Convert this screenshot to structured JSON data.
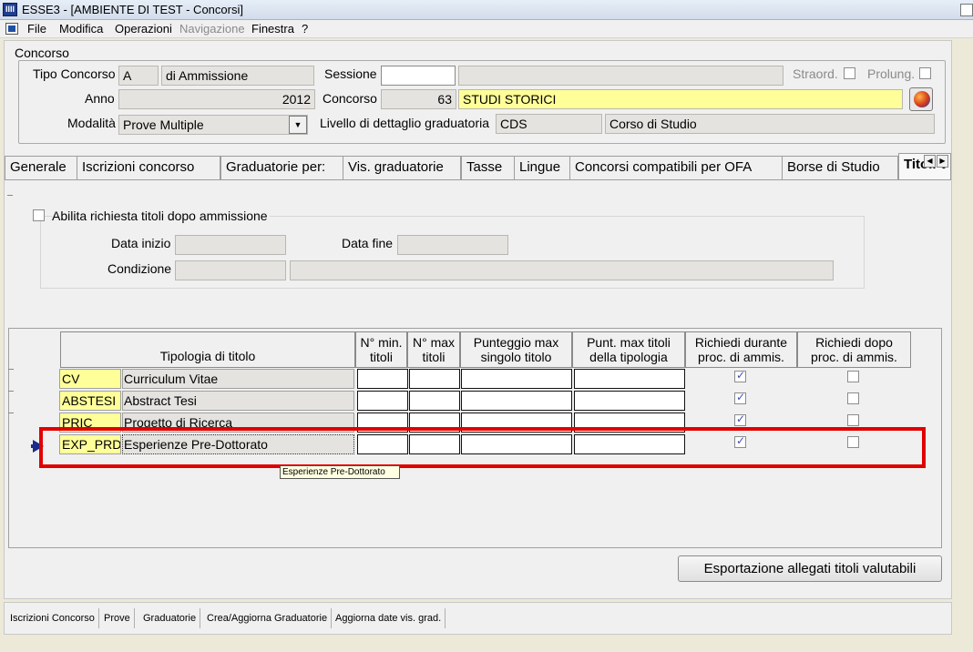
{
  "window": {
    "title": "ESSE3 - [AMBIENTE DI TEST - Concorsi]",
    "app_icon_text": "IIII"
  },
  "menu": {
    "items": [
      "File",
      "Modifica",
      "Operazioni",
      "Navigazione",
      "Finestra",
      "?"
    ],
    "disabled": [
      "Navigazione"
    ]
  },
  "concorso": {
    "group_title": "Concorso",
    "tipo_label": "Tipo Concorso",
    "tipo_code": "A",
    "tipo_desc": "di Ammissione",
    "sessione_label": "Sessione",
    "sessione_value": "",
    "sessione_desc": "",
    "straord_label": "Straord.",
    "prolung_label": "Prolung.",
    "anno_label": "Anno",
    "anno_value": "2012",
    "concorso_label": "Concorso",
    "concorso_code": "63",
    "concorso_desc": "STUDI STORICI",
    "modalita_label": "Modalità",
    "modalita_value": "Prove Multiple",
    "livello_label": "Livello di dettaglio graduatoria",
    "livello_code": "CDS",
    "livello_desc": "Corso di Studio"
  },
  "tabs": [
    "Generale",
    "Iscrizioni concorso",
    "Graduatorie per:",
    "Vis. graduatorie",
    "Tasse",
    "Lingue",
    "Concorsi compatibili per OFA",
    "Borse di Studio",
    "Titoli v"
  ],
  "active_tab": "Titoli v",
  "abilita": {
    "checkbox_label": "Abilita richiesta titoli dopo ammissione",
    "data_inizio_label": "Data inizio",
    "data_fine_label": "Data fine",
    "condizione_label": "Condizione"
  },
  "table": {
    "headers": {
      "tipologia": "Tipologia di titolo",
      "min_1": "N° min.",
      "min_2": "titoli",
      "max_1": "N° max",
      "max_2": "titoli",
      "punt_1": "Punteggio max",
      "punt_2": "singolo titolo",
      "puntmax_1": "Punt. max titoli",
      "puntmax_2": "della  tipologia",
      "rich_dur_1": "Richiedi durante",
      "rich_dur_2": "proc. di ammis.",
      "rich_dopo_1": "Richiedi dopo",
      "rich_dopo_2": "proc. di ammis."
    },
    "rows": [
      {
        "code": "CV",
        "desc": "Curriculum Vitae",
        "durante": true,
        "dopo": false
      },
      {
        "code": "ABSTESI",
        "desc": "Abstract Tesi",
        "durante": true,
        "dopo": false
      },
      {
        "code": "PRIC",
        "desc": "Progetto di Ricerca",
        "durante": true,
        "dopo": false
      },
      {
        "code": "EXP_PRDO",
        "desc": "Esperienze Pre-Dottorato",
        "durante": true,
        "dopo": false
      }
    ],
    "tooltip": "Esperienze Pre-Dottorato"
  },
  "export_button": "Esportazione allegati titoli valutabili",
  "bottom_toolbar": [
    "Iscrizioni Concorso",
    "Prove",
    "Graduatorie",
    "Crea/Aggiorna Graduatorie",
    "Aggiorna date vis. grad."
  ]
}
